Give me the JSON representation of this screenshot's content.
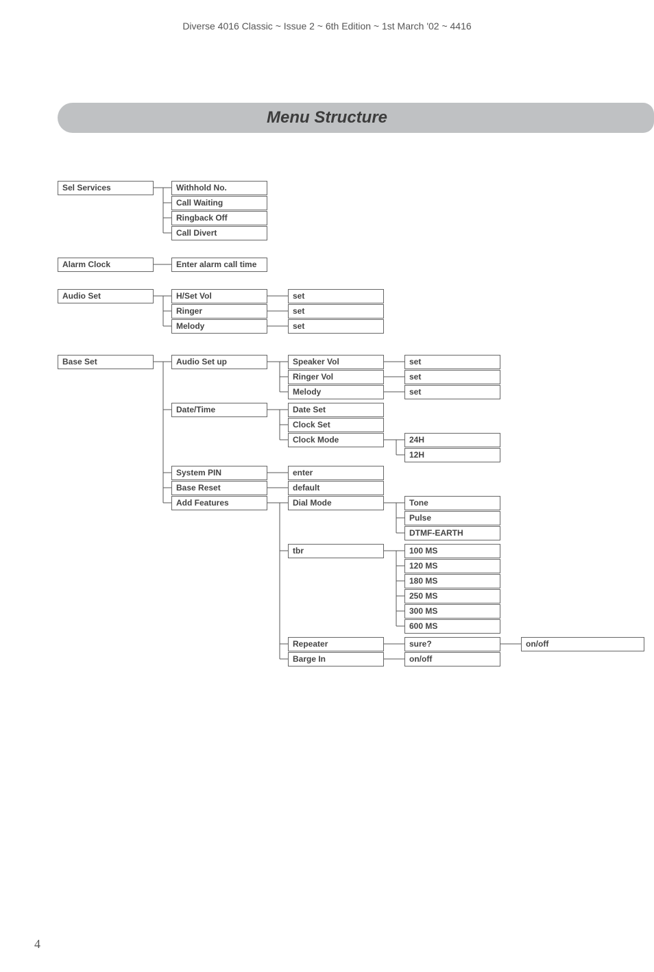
{
  "header": "Diverse 4016 Classic ~ Issue 2 ~ 6th Edition ~ 1st March '02 ~ 4416",
  "title": "Menu Structure",
  "page_number": "4",
  "col1": {
    "sel_services": "Sel Services",
    "alarm_clock": "Alarm Clock",
    "audio_set": "Audio Set",
    "base_set": "Base Set"
  },
  "col2": {
    "withhold_no": "Withhold No.",
    "call_waiting": "Call Waiting",
    "ringback_off": "Ringback Off",
    "call_divert": "Call Divert",
    "enter_alarm": "Enter alarm call time",
    "hset_vol": "H/Set Vol",
    "ringer": "Ringer",
    "melody": "Melody",
    "audio_set_up": "Audio Set up",
    "date_time": "Date/Time",
    "system_pin": "System PIN",
    "base_reset": "Base Reset",
    "add_features": "Add Features"
  },
  "col3": {
    "set1": "set",
    "set2": "set",
    "set3": "set",
    "speaker_vol": "Speaker Vol",
    "ringer_vol": "Ringer Vol",
    "melody2": "Melody",
    "date_set": "Date Set",
    "clock_set": "Clock Set",
    "clock_mode": "Clock Mode",
    "enter": "enter",
    "default": "default",
    "dial_mode": "Dial Mode",
    "tbr": "tbr",
    "repeater": "Repeater",
    "barge_in": "Barge In"
  },
  "col4": {
    "setA": "set",
    "setB": "set",
    "setC": "set",
    "h24": "24H",
    "h12": "12H",
    "tone": "Tone",
    "pulse": "Pulse",
    "dtmf_earth": "DTMF-EARTH",
    "ms100": "100 MS",
    "ms120": "120 MS",
    "ms180": "180 MS",
    "ms250": "250 MS",
    "ms300": "300 MS",
    "ms600": "600 MS",
    "sure": "sure?",
    "onoff": "on/off"
  },
  "col5": {
    "onoff": "on/off"
  }
}
